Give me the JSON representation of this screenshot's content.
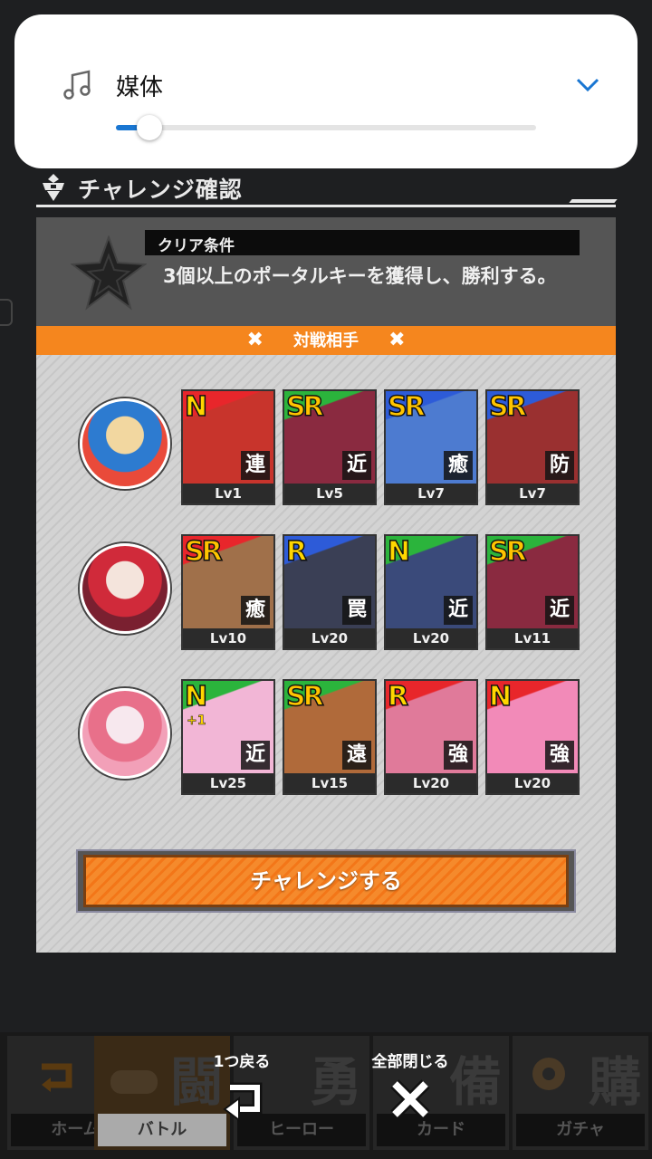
{
  "volume": {
    "label": "媒体",
    "level_percent": 8,
    "icons": {
      "music": "music-note-icon",
      "expand": "chevron-down-icon"
    }
  },
  "header": {
    "title": "チャレンジ確認",
    "icon": "robot-emblem-icon"
  },
  "condition": {
    "label": "クリア条件",
    "text": "3個以上のポータルキーを獲得し、勝利する。",
    "icon": "star-icon"
  },
  "opponents": {
    "label": "対戦相手",
    "rows": [
      {
        "avatar": "pixel-king-avatar",
        "cards": [
          {
            "rarity": "N",
            "type": "連",
            "level": "Lv1",
            "color": "#e8262b",
            "art": "#c8342c"
          },
          {
            "rarity": "SR",
            "type": "近",
            "level": "Lv5",
            "color": "#2bb43c",
            "art": "#8a2a40"
          },
          {
            "rarity": "SR",
            "type": "癒",
            "level": "Lv7",
            "color": "#2d5bd8",
            "art": "#4d7bd0"
          },
          {
            "rarity": "SR",
            "type": "防",
            "level": "Lv7",
            "color": "#2d5bd8",
            "art": "#9a3030"
          }
        ]
      },
      {
        "avatar": "red-hair-girl-avatar",
        "cards": [
          {
            "rarity": "SR",
            "type": "癒",
            "level": "Lv10",
            "color": "#e8262b",
            "art": "#a0704a"
          },
          {
            "rarity": "R",
            "type": "罠",
            "level": "Lv20",
            "color": "#2d5bd8",
            "art": "#3a3f55"
          },
          {
            "rarity": "N",
            "type": "近",
            "level": "Lv20",
            "color": "#2bb43c",
            "art": "#3a4a7a"
          },
          {
            "rarity": "SR",
            "type": "近",
            "level": "Lv11",
            "color": "#2bb43c",
            "art": "#8a2a40"
          }
        ]
      },
      {
        "avatar": "pink-hair-girl-avatar",
        "cards": [
          {
            "rarity": "N",
            "plus": "+1",
            "type": "近",
            "level": "Lv25",
            "color": "#2bb43c",
            "art": "#f2b6d6"
          },
          {
            "rarity": "SR",
            "type": "遠",
            "level": "Lv15",
            "color": "#2bb43c",
            "art": "#b06a3a"
          },
          {
            "rarity": "R",
            "type": "強",
            "level": "Lv20",
            "color": "#e8262b",
            "art": "#e07a9a"
          },
          {
            "rarity": "N",
            "type": "強",
            "level": "Lv20",
            "color": "#e8262b",
            "art": "#f28ab8"
          }
        ]
      }
    ]
  },
  "challenge_button": {
    "label": "チャレンジする"
  },
  "nav": {
    "items": [
      {
        "big": "",
        "label": "ホーム",
        "icon": "home-return-icon"
      },
      {
        "big": "闘",
        "label": "バトル",
        "icon": "gamepad-icon"
      },
      {
        "big": "勇",
        "label": "ヒーロー",
        "icon": "star-icon"
      },
      {
        "big": "備",
        "label": "カード",
        "icon": "card-icon"
      },
      {
        "big": "購",
        "label": "ガチャ",
        "icon": "gacha-icon"
      }
    ]
  },
  "overlay": {
    "back_label": "1つ戻る",
    "close_all_label": "全部閉じる"
  }
}
